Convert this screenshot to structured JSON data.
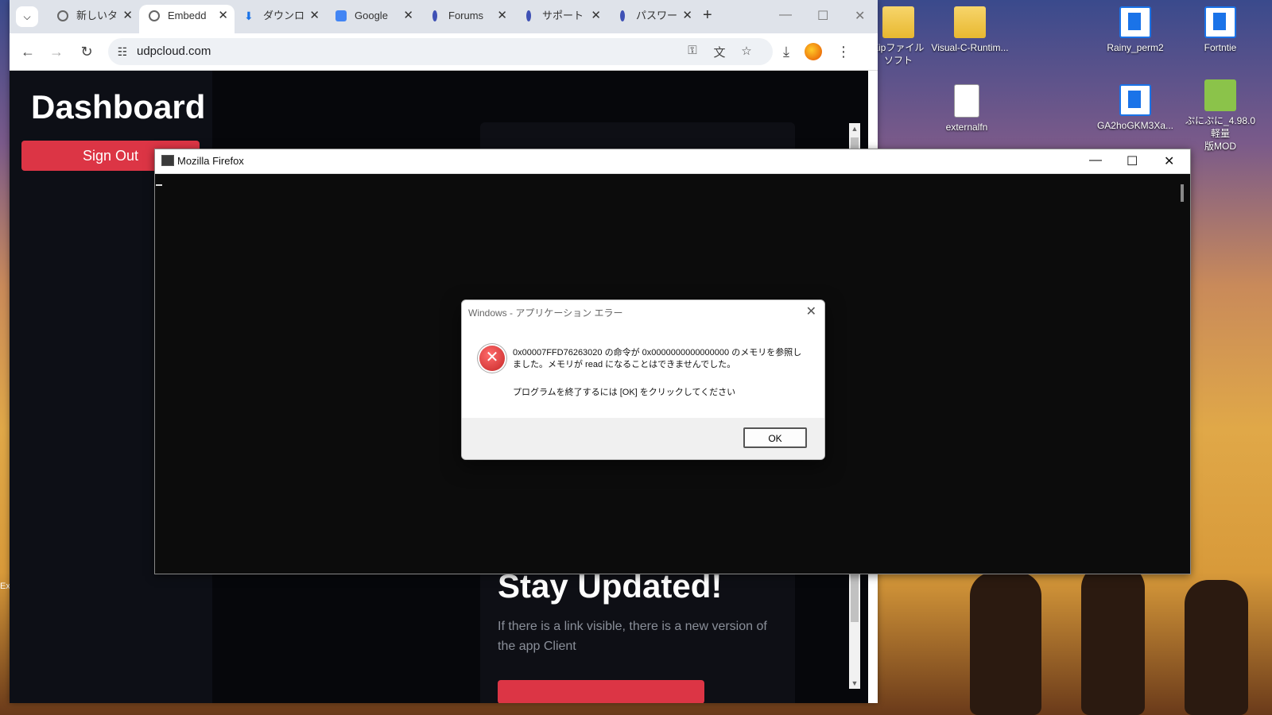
{
  "desktop": {
    "icons": [
      {
        "label": "Zipファイル\nソフト"
      },
      {
        "label": "Visual-C-Runtim..."
      },
      {
        "label": "Rainy_perm2"
      },
      {
        "label": "Fortntie"
      },
      {
        "label": "externalfn"
      },
      {
        "label": "GA2hoGKM3Xa..."
      },
      {
        "label": "ぷにぷに_4.98.0軽量\n版MOD"
      }
    ],
    "edge_text": "Ex"
  },
  "chrome": {
    "tabs": [
      {
        "title": "新しいタ",
        "icon": "globe-icon"
      },
      {
        "title": "Embedd",
        "icon": "globe-icon"
      },
      {
        "title": "ダウンロ",
        "icon": "download-icon"
      },
      {
        "title": "Google",
        "icon": "translate-icon"
      },
      {
        "title": "Forums",
        "icon": "site-icon"
      },
      {
        "title": "サポート",
        "icon": "site-icon"
      },
      {
        "title": "パスワー",
        "icon": "site-icon"
      }
    ],
    "new_tab": "+",
    "url": "udpcloud.com"
  },
  "page": {
    "dashboard_title": "Dashboard",
    "sign_out": "Sign Out",
    "stay_title": "Stay Updated!",
    "stay_text": "If there is a link visible, there is a new version of the app Client"
  },
  "firefox_window": {
    "title": "Mozilla Firefox"
  },
  "error_dialog": {
    "title": "Windows - アプリケーション エラー",
    "message": "0x00007FFD76263020 の命令が 0x0000000000000000 のメモリを参照しました。メモリが read になることはできませんでした。",
    "instruction": "プログラムを終了するには [OK] をクリックしてください",
    "ok_label": "OK"
  },
  "colors": {
    "accent_red": "#dc3545",
    "page_bg": "#06070b"
  }
}
